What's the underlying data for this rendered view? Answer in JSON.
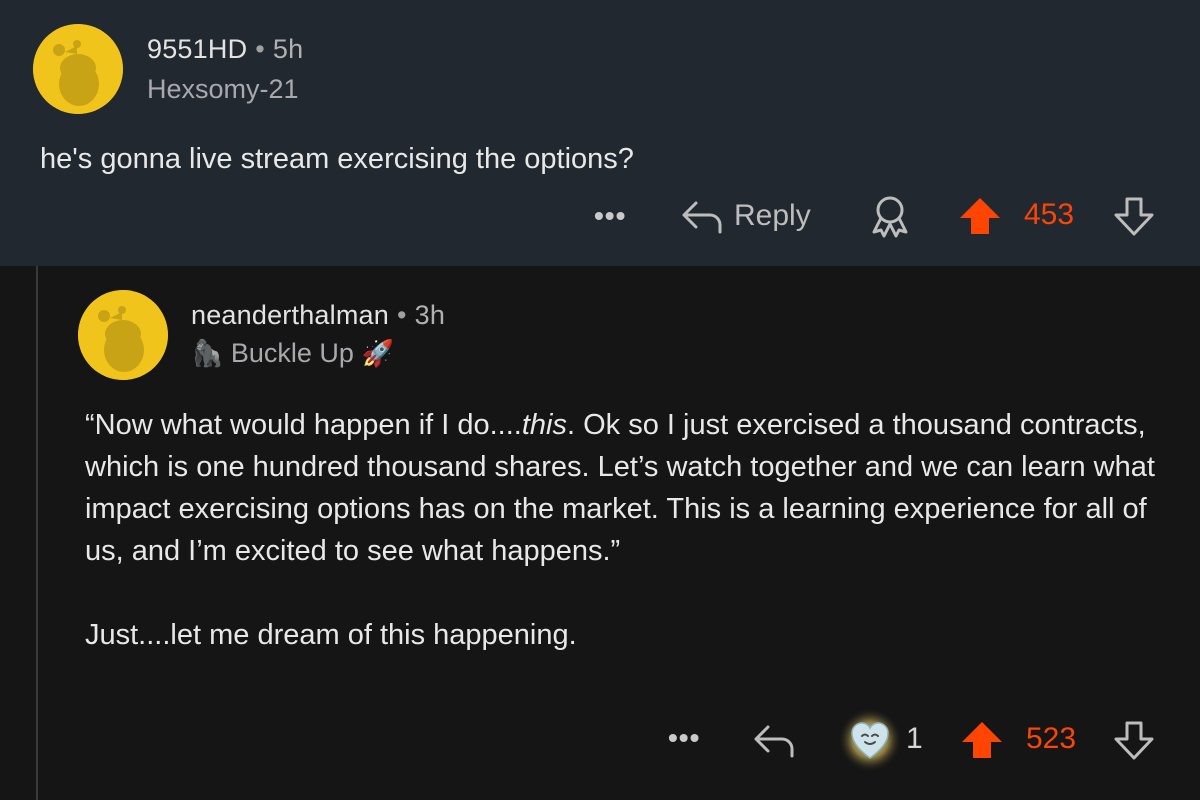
{
  "top_comment": {
    "username": "9551HD",
    "separator": "•",
    "time": "5h",
    "flair": "Hexsomy-21",
    "body": "he's gonna live stream exercising the options?",
    "actions": {
      "more_icon": "•••",
      "reply_label": "Reply",
      "award_icon": "award-ribbon-icon",
      "upvote_icon": "upvote-arrow-icon",
      "score": "453",
      "downvote_icon": "downvote-arrow-icon"
    }
  },
  "reply_comment": {
    "username": "neanderthalman",
    "separator": "•",
    "time": "3h",
    "flair_left_emoji": "🦍",
    "flair": "Buckle Up",
    "flair_right_emoji": "🚀",
    "body": {
      "quote_start": "“Now what would happen if I do....",
      "quote_italic": "this",
      "quote_rest": ".  Ok so I just exercised a thousand contracts, which is one hundred thousand shares. Let’s watch together and we can learn what impact exercising options has on the market. This is a learning experience for all of us, and I’m excited to see what happens.”",
      "closing": "Just....let me dream of this happening."
    },
    "actions": {
      "more_icon": "•••",
      "reply_icon": "reply-arrow-icon",
      "award_icon": "wholesome-award-icon",
      "award_count": "1",
      "upvote_icon": "upvote-arrow-icon",
      "score": "523",
      "downvote_icon": "downvote-arrow-icon"
    }
  },
  "colors": {
    "top_bg": "#222830",
    "reply_bg": "#151515",
    "avatar": "#f0c41b",
    "upvote": "#ff4500",
    "text": "#e8e8e8"
  }
}
